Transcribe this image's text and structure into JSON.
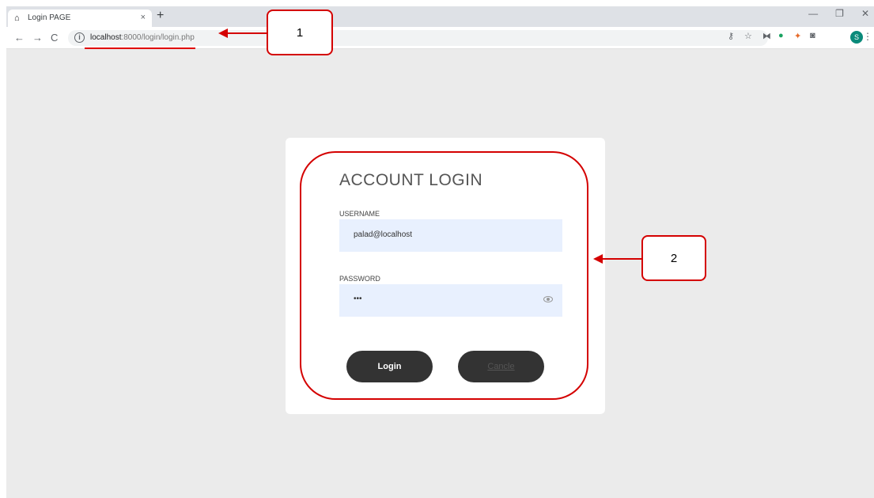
{
  "browser": {
    "tab_title": "Login PAGE",
    "tab_close": "×",
    "new_tab": "+",
    "window_minimize": "—",
    "window_restore": "❐",
    "window_close": "✕",
    "nav_back": "←",
    "nav_forward": "→",
    "nav_reload": "C",
    "info_symbol": "i",
    "url_host": "localhost",
    "url_path": ":8000/login/login.php",
    "profile_initial": "S",
    "menu": "⋮",
    "toolbar_icons": [
      "key-icon",
      "star-icon",
      "extension-icon",
      "grammarly-icon",
      "metamask-icon",
      "camera-icon"
    ]
  },
  "login": {
    "title": "ACCOUNT LOGIN",
    "username_label": "USERNAME",
    "username_value": "palad@localhost",
    "password_label": "PASSWORD",
    "password_value": "•••",
    "login_button": "Login",
    "cancel_button": "Cancle"
  },
  "annotations": {
    "callout_1": "1",
    "callout_2": "2",
    "color": "#d40000"
  }
}
